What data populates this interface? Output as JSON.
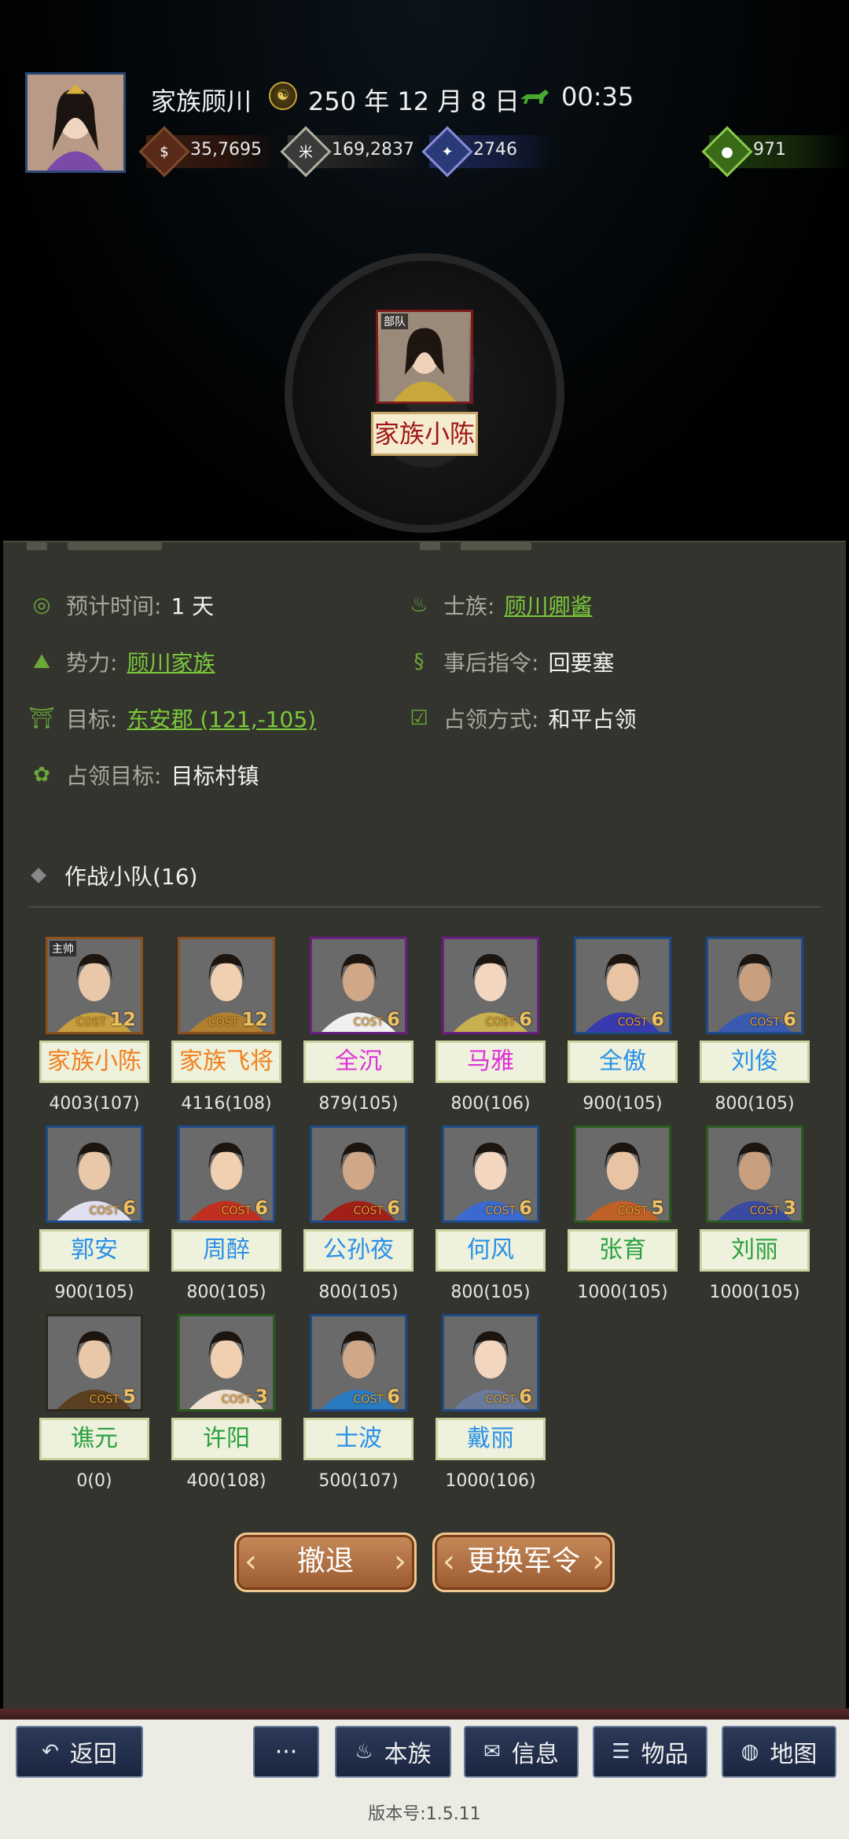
{
  "header": {
    "player_name": "家族顾川",
    "date": "250 年 12 月 8 日",
    "time": "00:35",
    "resources": {
      "coin": "35,7695",
      "grain": "169,2837",
      "troops": "2746",
      "gold": "971"
    }
  },
  "unit": {
    "tag": "部队",
    "name": "家族小陈"
  },
  "info": {
    "eta_label": "预计时间:",
    "eta_value": "1 天",
    "clan_label": "士族:",
    "clan_value": "顾川卿酱",
    "faction_label": "势力:",
    "faction_value": "顾川家族",
    "after_label": "事后指令:",
    "after_value": "回要塞",
    "target_label": "目标:",
    "target_value": "东安郡 (121,-105)",
    "occupy_label": "占领方式:",
    "occupy_value": "和平占领",
    "occupy_target_label": "占领目标:",
    "occupy_target_value": "目标村镇"
  },
  "squad": {
    "title": "作战小队(16)",
    "leader_tag": "主帅",
    "cost_label": "COST",
    "generals": [
      {
        "name": "家族小陈",
        "troops": "4003(107)",
        "cost": "12",
        "name_color": "#f08020",
        "frame": "#8a5020"
      },
      {
        "name": "家族飞将",
        "troops": "4116(108)",
        "cost": "12",
        "name_color": "#f08020",
        "frame": "#8a5020"
      },
      {
        "name": "全沉",
        "troops": "879(105)",
        "cost": "6",
        "name_color": "#e030d8",
        "frame": "#6a2080"
      },
      {
        "name": "马雅",
        "troops": "800(106)",
        "cost": "6",
        "name_color": "#e030d8",
        "frame": "#6a2080"
      },
      {
        "name": "全傲",
        "troops": "900(105)",
        "cost": "6",
        "name_color": "#2a90e8",
        "frame": "#1e4a88"
      },
      {
        "name": "刘俊",
        "troops": "800(105)",
        "cost": "6",
        "name_color": "#2a90e8",
        "frame": "#1e4a88"
      },
      {
        "name": "郭安",
        "troops": "900(105)",
        "cost": "6",
        "name_color": "#2a90e8",
        "frame": "#1e4a88"
      },
      {
        "name": "周醉",
        "troops": "800(105)",
        "cost": "6",
        "name_color": "#2a90e8",
        "frame": "#1e4a88"
      },
      {
        "name": "公孙夜",
        "troops": "800(105)",
        "cost": "6",
        "name_color": "#2a90e8",
        "frame": "#1e4a88"
      },
      {
        "name": "何风",
        "troops": "800(105)",
        "cost": "6",
        "name_color": "#2a90e8",
        "frame": "#1e4a88"
      },
      {
        "name": "张育",
        "troops": "1000(105)",
        "cost": "5",
        "name_color": "#2aa040",
        "frame": "#2a5a20"
      },
      {
        "name": "刘丽",
        "troops": "1000(105)",
        "cost": "3",
        "name_color": "#2aa040",
        "frame": "#2a5a20"
      },
      {
        "name": "谯元",
        "troops": "0(0)",
        "cost": "5",
        "name_color": "#2aa040",
        "frame": "#2a2a20"
      },
      {
        "name": "许阳",
        "troops": "400(108)",
        "cost": "3",
        "name_color": "#2aa040",
        "frame": "#2a5a20"
      },
      {
        "name": "士波",
        "troops": "500(107)",
        "cost": "6",
        "name_color": "#2a90e8",
        "frame": "#1e4a88"
      },
      {
        "name": "戴丽",
        "troops": "1000(106)",
        "cost": "6",
        "name_color": "#2a90e8",
        "frame": "#1e4a88"
      }
    ]
  },
  "actions": {
    "retreat": "撤退",
    "change_order": "更换军令"
  },
  "nav": {
    "back": "返回",
    "more": "···",
    "clan": "本族",
    "info": "信息",
    "items": "物品",
    "map": "地图"
  },
  "version": "版本号:1.5.11"
}
